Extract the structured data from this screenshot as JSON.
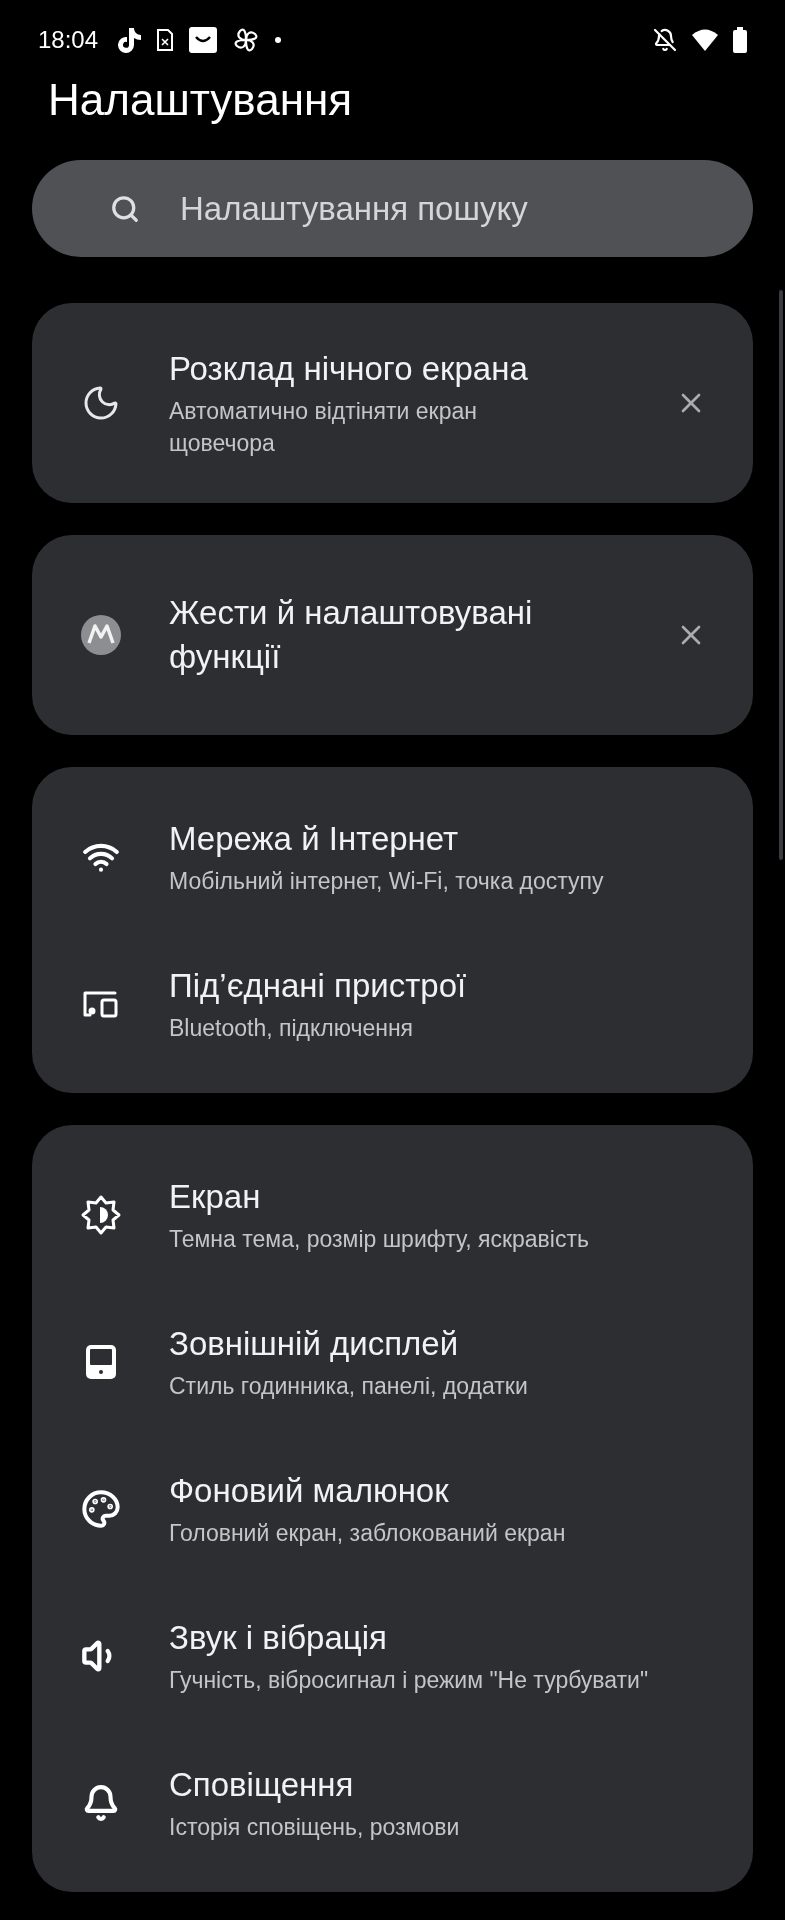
{
  "status_bar": {
    "time": "18:04"
  },
  "title": "Налаштування",
  "search": {
    "placeholder": "Налаштування пошуку"
  },
  "suggestions": [
    {
      "title": "Розклад нічного екрана",
      "subtitle": "Автоматично відтіняти екран щовечора"
    },
    {
      "title": "Жести й налаштовувані функції"
    }
  ],
  "groups": [
    {
      "items": [
        {
          "title": "Мережа й Інтернет",
          "subtitle": "Мобільний інтернет, Wi-Fi, точка доступу"
        },
        {
          "title": "Під’єднані пристрої",
          "subtitle": "Bluetooth, підключення"
        }
      ]
    },
    {
      "items": [
        {
          "title": "Екран",
          "subtitle": "Темна тема, розмір шрифту, яскравість"
        },
        {
          "title": "Зовнішній дисплей",
          "subtitle": "Стиль годинника, панелі, додатки"
        },
        {
          "title": "Фоновий малюнок",
          "subtitle": "Головний екран, заблокований екран"
        },
        {
          "title": "Звук і вібрація",
          "subtitle": "Гучність, вібросигнал і режим \"Не турбувати\""
        },
        {
          "title": "Сповіщення",
          "subtitle": "Історія сповіщень, розмови"
        }
      ]
    }
  ]
}
